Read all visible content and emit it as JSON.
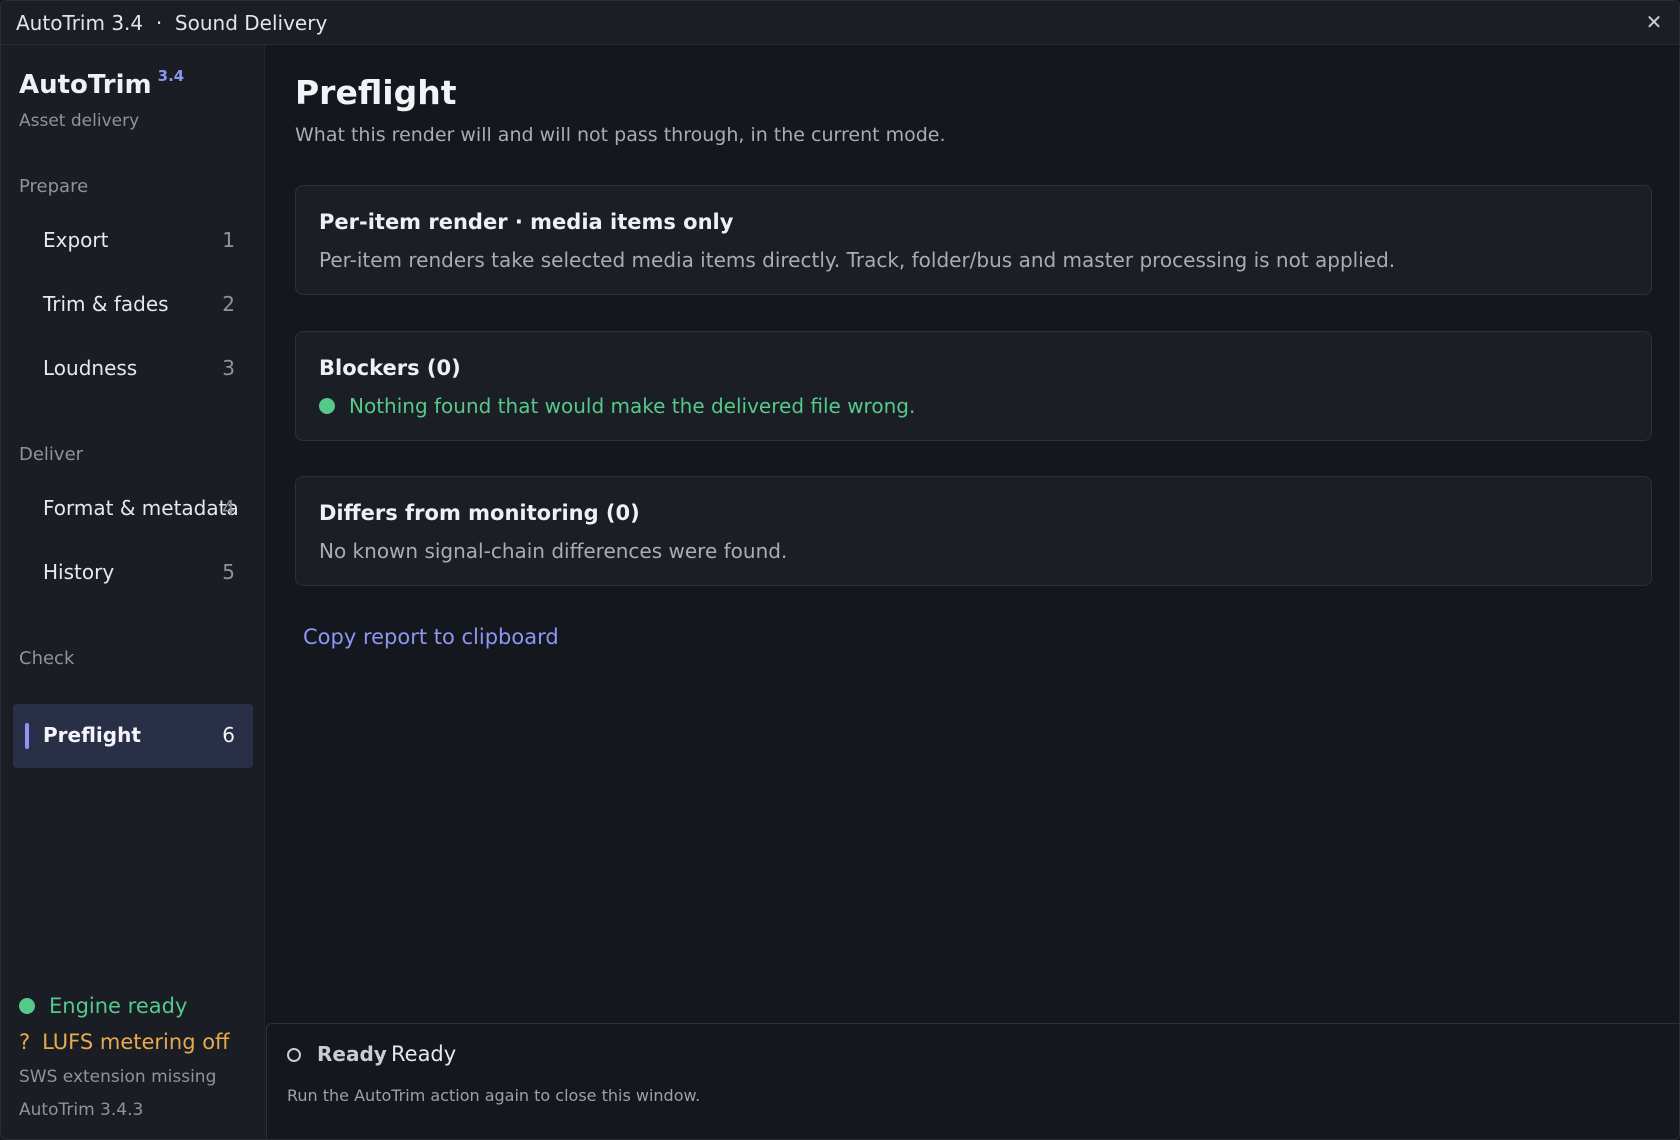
{
  "window": {
    "title": "AutoTrim 3.4  ·  Sound Delivery",
    "close_glyph": "✕"
  },
  "brand": {
    "name": "AutoTrim",
    "version": "3.4",
    "subtitle": "Asset delivery"
  },
  "sidebar": {
    "sections": [
      {
        "label": "Prepare",
        "items": [
          {
            "label": "Export",
            "number": "1"
          },
          {
            "label": "Trim & fades",
            "number": "2"
          },
          {
            "label": "Loudness",
            "number": "3"
          }
        ]
      },
      {
        "label": "Deliver",
        "items": [
          {
            "label": "Format & metadata",
            "number": "4"
          },
          {
            "label": "History",
            "number": "5"
          }
        ]
      },
      {
        "label": "Check",
        "items": [
          {
            "label": "Preflight",
            "number": "6",
            "active": true
          }
        ]
      }
    ],
    "footer": {
      "engine": "Engine ready",
      "lufs_prefix": "?",
      "lufs": "LUFS metering off",
      "sws": "SWS extension missing",
      "build": "AutoTrim 3.4.3"
    }
  },
  "main": {
    "title": "Preflight",
    "subtitle": "What this render will and will not pass through, in the current mode.",
    "cards": [
      {
        "title": "Per-item render · media items only",
        "body": "Per-item renders take selected media items directly. Track, folder/bus and master processing is not applied."
      },
      {
        "title": "Blockers (0)",
        "body": "Nothing found that would make the delivered file wrong."
      },
      {
        "title": "Differs from monitoring (0)",
        "body": "No known signal-chain differences were found."
      }
    ],
    "copy_link": "Copy report to clipboard"
  },
  "statusbar": {
    "state": "Ready",
    "message": "Ready",
    "hint": "Run the AutoTrim action again to close this window."
  },
  "colors": {
    "accent": "#8f95f2",
    "ok": "#55c98a",
    "warn": "#e8a94e",
    "background": "#14171d"
  },
  "icons": {
    "close": "close-icon",
    "ok_dot": "status-dot-icon",
    "ring": "status-ring-icon"
  }
}
